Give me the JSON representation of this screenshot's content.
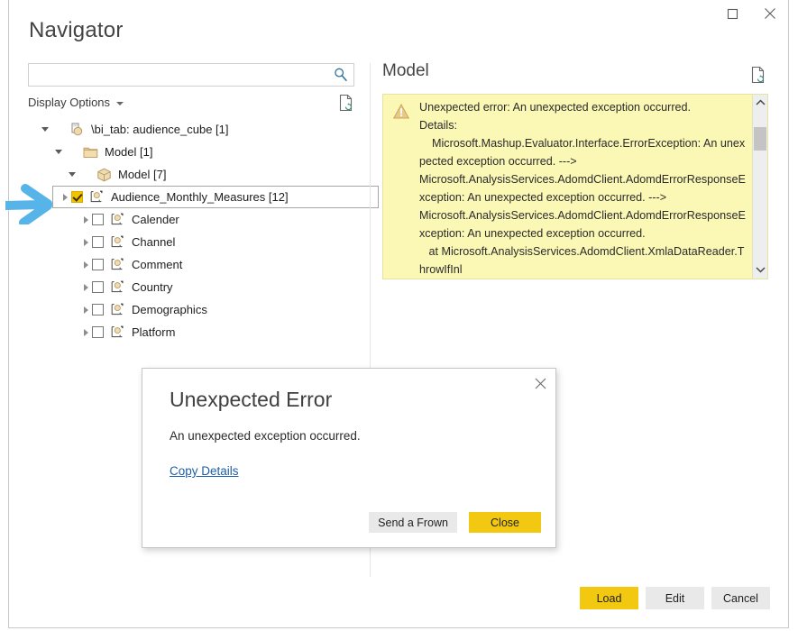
{
  "window": {
    "title": "Navigator",
    "controls": [
      {
        "name": "maximize",
        "glyph": "maximize-icon"
      },
      {
        "name": "close",
        "glyph": "close-icon"
      }
    ]
  },
  "search": {
    "value": "",
    "placeholder": "",
    "icon": "search-icon"
  },
  "display_options": {
    "label": "Display Options",
    "caret_icon": "chevron-down-icon",
    "refresh_icon": "refresh-document-icon"
  },
  "tree": {
    "nodes": [
      {
        "label": "\\bi_tab: audience_cube [1]",
        "indent": 0,
        "expanded": true,
        "icon": "database-server-icon",
        "checkbox": null,
        "selected": false
      },
      {
        "label": "Model [1]",
        "indent": 1,
        "expanded": true,
        "icon": "folder-icon",
        "checkbox": null,
        "selected": false
      },
      {
        "label": "Model [7]",
        "indent": 2,
        "expanded": true,
        "icon": "cube-icon",
        "checkbox": null,
        "selected": false
      },
      {
        "label": "Audience_Monthly_Measures [12]",
        "indent": 3,
        "expanded": false,
        "icon": "measure-table-icon",
        "checkbox": "checked",
        "selected": true
      },
      {
        "label": "Calender",
        "indent": 3,
        "expanded": false,
        "icon": "measure-table-icon",
        "checkbox": "unchecked",
        "selected": false
      },
      {
        "label": "Channel",
        "indent": 3,
        "expanded": false,
        "icon": "measure-table-icon",
        "checkbox": "unchecked",
        "selected": false
      },
      {
        "label": "Comment",
        "indent": 3,
        "expanded": false,
        "icon": "measure-table-icon",
        "checkbox": "unchecked",
        "selected": false
      },
      {
        "label": "Country",
        "indent": 3,
        "expanded": false,
        "icon": "measure-table-icon",
        "checkbox": "unchecked",
        "selected": false
      },
      {
        "label": "Demographics",
        "indent": 3,
        "expanded": false,
        "icon": "measure-table-icon",
        "checkbox": "unchecked",
        "selected": false
      },
      {
        "label": "Platform",
        "indent": 3,
        "expanded": false,
        "icon": "measure-table-icon",
        "checkbox": "unchecked",
        "selected": false
      }
    ]
  },
  "preview": {
    "title": "Model",
    "refresh_icon": "refresh-document-icon",
    "error": {
      "warning_icon": "warning-triangle-icon",
      "text": "Unexpected error: An unexpected exception occurred.\nDetails:\n    Microsoft.Mashup.Evaluator.Interface.ErrorException: An unexpected exception occurred. --->\nMicrosoft.AnalysisServices.AdomdClient.AdomdErrorResponseException: An unexpected exception occurred. --->\nMicrosoft.AnalysisServices.AdomdClient.AdomdErrorResponseException: An unexpected exception occurred.\n   at Microsoft.AnalysisServices.AdomdClient.XmlaDataReader.ThrowIfInl",
      "scrollbar": {
        "up_icon": "chevron-up-icon",
        "down_icon": "chevron-down-icon"
      },
      "background_color": "#fbf7b5"
    }
  },
  "dialog": {
    "title": "Unexpected Error",
    "message": "An unexpected exception occurred.",
    "link_label": "Copy Details",
    "close_icon": "close-icon",
    "buttons": [
      {
        "label": "Send a Frown",
        "primary": false
      },
      {
        "label": "Close",
        "primary": true
      }
    ]
  },
  "footer": {
    "buttons": [
      {
        "label": "Load",
        "primary": true
      },
      {
        "label": "Edit",
        "primary": false
      },
      {
        "label": "Cancel",
        "primary": false
      }
    ]
  },
  "annotation": {
    "arrow_icon": "blue-arrow-right-icon",
    "color": "#56b4e8"
  },
  "theme": {
    "accent": "#f2c811",
    "warning_bg": "#fbf7b5",
    "link": "#1c5fa8"
  }
}
